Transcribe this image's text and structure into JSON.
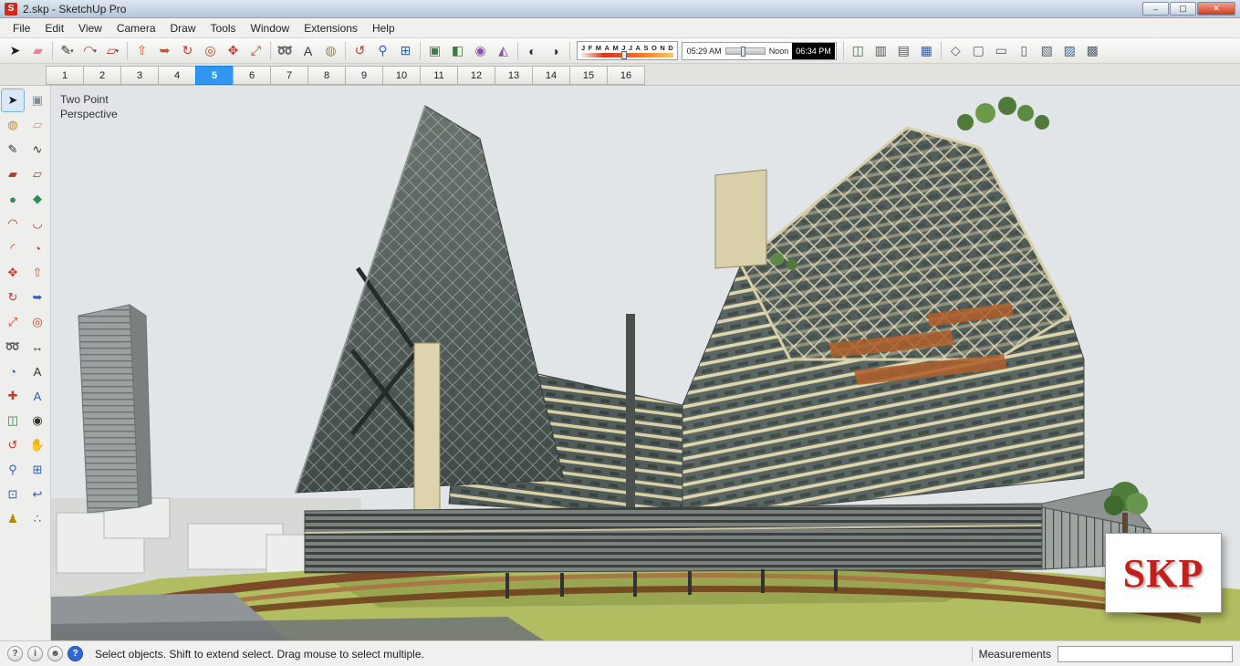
{
  "window": {
    "title": "2.skp - SketchUp Pro",
    "app_icon": "sketchup-logo",
    "minimize_label": "–",
    "maximize_label": "▢",
    "close_label": "✕"
  },
  "menu_bar": {
    "items": [
      "File",
      "Edit",
      "View",
      "Camera",
      "Draw",
      "Tools",
      "Window",
      "Extensions",
      "Help"
    ]
  },
  "toolbar": {
    "groups_left": [
      {
        "name": "principal",
        "icons": [
          {
            "name": "select-tool-icon",
            "glyph": "➤",
            "color": "#1a1a1a"
          },
          {
            "name": "eraser-tool-icon",
            "glyph": "▰",
            "color": "#d98a9b"
          }
        ]
      },
      {
        "name": "drawing",
        "icons": [
          {
            "name": "line-tool-icon",
            "glyph": "✎",
            "color": "#333333",
            "dropdown": true
          },
          {
            "name": "arc-tool-icon",
            "glyph": "◠",
            "color": "#b03a2e",
            "dropdown": true
          },
          {
            "name": "shape-tool-icon",
            "glyph": "▱",
            "color": "#b03a2e",
            "dropdown": true
          }
        ]
      },
      {
        "name": "modification",
        "icons": [
          {
            "name": "push-pull-tool-icon",
            "glyph": "⇧",
            "color": "#c0592b"
          },
          {
            "name": "follow-me-tool-icon",
            "glyph": "➥",
            "color": "#c0592b"
          },
          {
            "name": "rotate-tool-icon",
            "glyph": "↻",
            "color": "#c23b2e"
          },
          {
            "name": "offset-tool-icon",
            "glyph": "◎",
            "color": "#c23b2e"
          },
          {
            "name": "move-tool-icon",
            "glyph": "✥",
            "color": "#c23b2e"
          },
          {
            "name": "scale-tool-icon",
            "glyph": "⤢",
            "color": "#c23b2e"
          }
        ]
      },
      {
        "name": "construction",
        "icons": [
          {
            "name": "tape-measure-tool-icon",
            "glyph": "➿",
            "color": "#b8860b"
          },
          {
            "name": "text-tool-icon",
            "glyph": "A",
            "color": "#333333"
          },
          {
            "name": "paint-bucket-tool-icon",
            "glyph": "◍",
            "color": "#b8860b"
          }
        ]
      },
      {
        "name": "camera-tools",
        "icons": [
          {
            "name": "orbit-tool-icon",
            "glyph": "↺",
            "color": "#c23b2e"
          },
          {
            "name": "zoom-tool-icon",
            "glyph": "⚲",
            "color": "#2e5fb0"
          },
          {
            "name": "zoom-extents-tool-icon",
            "glyph": "⊞",
            "color": "#2e5fb0"
          }
        ]
      },
      {
        "name": "solid-tools",
        "icons": [
          {
            "name": "outer-shell-icon",
            "glyph": "▣",
            "color": "#3a7d44"
          },
          {
            "name": "intersect-icon",
            "glyph": "◧",
            "color": "#3a7d44"
          },
          {
            "name": "union-icon",
            "glyph": "◉",
            "color": "#8a4fb0"
          },
          {
            "name": "subtract-icon",
            "glyph": "◭",
            "color": "#8a4fb0"
          }
        ]
      },
      {
        "name": "display",
        "icons": [
          {
            "name": "shadows-toggle-icon",
            "glyph": "◐",
            "color": "#333333"
          },
          {
            "name": "xray-toggle-icon",
            "glyph": "◑",
            "color": "#333333"
          }
        ]
      }
    ],
    "shadow_controls": {
      "months": [
        "J",
        "F",
        "M",
        "A",
        "M",
        "J",
        "J",
        "A",
        "S",
        "O",
        "N",
        "D"
      ],
      "time_start": "05:29 AM",
      "time_noon": "Noon",
      "time_end": "06:34 PM"
    },
    "groups_right": [
      {
        "name": "section",
        "icons": [
          {
            "name": "section-plane-tool-icon",
            "glyph": "◫",
            "color": "#3a7d44"
          },
          {
            "name": "display-section-planes-icon",
            "glyph": "▥",
            "color": "#555555"
          },
          {
            "name": "display-section-cuts-icon",
            "glyph": "▤",
            "color": "#555555"
          },
          {
            "name": "section-fill-icon",
            "glyph": "▦",
            "color": "#2e5fb0"
          }
        ]
      },
      {
        "name": "face-styles",
        "icons": [
          {
            "name": "xray-style-icon",
            "glyph": "◇",
            "color": "#55606b"
          },
          {
            "name": "back-edges-style-icon",
            "glyph": "▢",
            "color": "#55606b"
          },
          {
            "name": "wireframe-style-icon",
            "glyph": "▭",
            "color": "#55606b"
          },
          {
            "name": "hidden-line-style-icon",
            "glyph": "▯",
            "color": "#55606b"
          },
          {
            "name": "shaded-style-icon",
            "glyph": "▧",
            "color": "#55606b"
          },
          {
            "name": "shaded-textures-style-icon",
            "glyph": "▨",
            "color": "#2e5fb0"
          },
          {
            "name": "monochrome-style-icon",
            "glyph": "▩",
            "color": "#55606b"
          }
        ]
      }
    ]
  },
  "scene_tabs": {
    "items": [
      "1",
      "2",
      "3",
      "4",
      "5",
      "6",
      "7",
      "8",
      "9",
      "10",
      "11",
      "12",
      "13",
      "14",
      "15",
      "16"
    ],
    "selected_index": 4
  },
  "large_tool_set": {
    "tools": [
      {
        "name": "select-tool",
        "glyph": "➤",
        "color": "#1a1a1a",
        "active": true
      },
      {
        "name": "make-component-tool",
        "glyph": "▣",
        "color": "#7d8a96"
      },
      {
        "name": "paint-bucket-tool",
        "glyph": "◍",
        "color": "#c28e2a"
      },
      {
        "name": "eraser-tool",
        "glyph": "▱",
        "color": "#d98a9b"
      },
      {
        "name": "line-tool",
        "glyph": "✎",
        "color": "#333333"
      },
      {
        "name": "freehand-tool",
        "glyph": "∿",
        "color": "#333333"
      },
      {
        "name": "rectangle-tool",
        "glyph": "▰",
        "color": "#b23a2e"
      },
      {
        "name": "rotated-rectangle-tool",
        "glyph": "▱",
        "color": "#b23a2e"
      },
      {
        "name": "circle-tool",
        "glyph": "●",
        "color": "#2e8b57"
      },
      {
        "name": "polygon-tool",
        "glyph": "◆",
        "color": "#2e8b57"
      },
      {
        "name": "arc-tool",
        "glyph": "◠",
        "color": "#b23a2e"
      },
      {
        "name": "two-point-arc-tool",
        "glyph": "◡",
        "color": "#b23a2e"
      },
      {
        "name": "three-point-arc-tool",
        "glyph": "◜",
        "color": "#b23a2e"
      },
      {
        "name": "pie-tool",
        "glyph": "◔",
        "color": "#b23a2e"
      },
      {
        "name": "move-tool",
        "glyph": "✥",
        "color": "#c0392b"
      },
      {
        "name": "push-pull-tool",
        "glyph": "⇧",
        "color": "#c0592b"
      },
      {
        "name": "rotate-tool",
        "glyph": "↻",
        "color": "#c0392b"
      },
      {
        "name": "follow-me-tool",
        "glyph": "➥",
        "color": "#2e5fb0"
      },
      {
        "name": "scale-tool",
        "glyph": "⤢",
        "color": "#c0392b"
      },
      {
        "name": "offset-tool",
        "glyph": "◎",
        "color": "#c0392b"
      },
      {
        "name": "tape-measure-tool",
        "glyph": "➿",
        "color": "#b8860b"
      },
      {
        "name": "dimension-tool",
        "glyph": "↔",
        "color": "#333333"
      },
      {
        "name": "protractor-tool",
        "glyph": "◔",
        "color": "#2e5fb0"
      },
      {
        "name": "text-tool",
        "glyph": "A",
        "color": "#333333"
      },
      {
        "name": "axes-tool",
        "glyph": "✚",
        "color": "#c0392b"
      },
      {
        "name": "3d-text-tool",
        "glyph": "A",
        "color": "#2e5fb0"
      },
      {
        "name": "section-plane-tool",
        "glyph": "◫",
        "color": "#3a7d44"
      },
      {
        "name": "look-around-tool",
        "glyph": "◉",
        "color": "#333333"
      },
      {
        "name": "orbit-tool",
        "glyph": "↺",
        "color": "#c0392b"
      },
      {
        "name": "pan-tool",
        "glyph": "✋",
        "color": "#c77a7a"
      },
      {
        "name": "zoom-tool",
        "glyph": "⚲",
        "color": "#2e5fb0"
      },
      {
        "name": "zoom-window-tool",
        "glyph": "⊞",
        "color": "#2e5fb0"
      },
      {
        "name": "zoom-extents-tool",
        "glyph": "⊡",
        "color": "#2e5fb0"
      },
      {
        "name": "zoom-previous-tool",
        "glyph": "↩",
        "color": "#2e5fb0"
      },
      {
        "name": "position-camera-tool",
        "glyph": "♟",
        "color": "#b8860b"
      },
      {
        "name": "walk-tool",
        "glyph": "∴",
        "color": "#6b4e2e"
      }
    ]
  },
  "viewport": {
    "camera_label_line1": "Two Point",
    "camera_label_line2": "Perspective",
    "watermark_text": "SKP"
  },
  "status_bar": {
    "icons": [
      {
        "name": "geolocation-status-icon",
        "glyph": "?",
        "accent": false
      },
      {
        "name": "credits-status-icon",
        "glyph": "i",
        "accent": false
      },
      {
        "name": "sign-in-status-icon",
        "glyph": "☻",
        "accent": false
      },
      {
        "name": "help-status-icon",
        "glyph": "?",
        "accent": true
      }
    ],
    "hint": "Select objects. Shift to extend select. Drag mouse to select multiple.",
    "measurements_label": "Measurements",
    "measurements_value": ""
  }
}
